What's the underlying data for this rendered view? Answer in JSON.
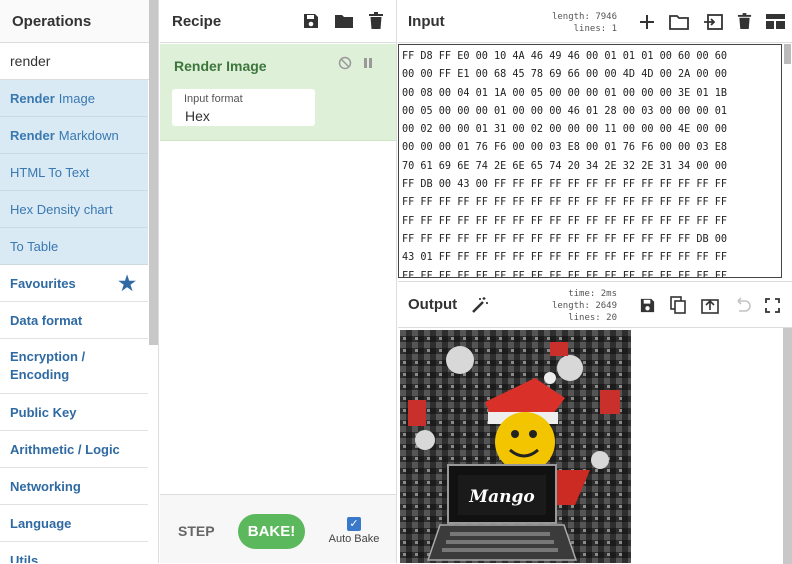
{
  "operations": {
    "title": "Operations",
    "search_value": "render",
    "results": [
      {
        "bold": "Render",
        "rest": "Image"
      },
      {
        "bold": "Render",
        "rest": "Markdown"
      },
      {
        "bold": "",
        "rest": "HTML To Text"
      },
      {
        "bold": "",
        "rest": "Hex Density chart"
      },
      {
        "bold": "",
        "rest": "To Table"
      }
    ],
    "categories": [
      "Favourites",
      "Data format",
      "Encryption / Encoding",
      "Public Key",
      "Arithmetic / Logic",
      "Networking",
      "Language",
      "Utils"
    ]
  },
  "recipe": {
    "title": "Recipe",
    "ingredient": {
      "name": "Render Image",
      "field_label": "Input format",
      "field_value": "Hex"
    },
    "step_label": "STEP",
    "bake_label": "BAKE!",
    "auto_bake_label": "Auto Bake"
  },
  "input": {
    "title": "Input",
    "length_label": "length:",
    "length_value": "7946",
    "lines_label": "lines:",
    "lines_value": "1",
    "hex_lines": [
      "FF D8 FF E0 00 10 4A 46 49 46 00 01 01 01 00 60 00 60",
      "00 00 FF E1 00 68 45 78 69 66 00 00 4D 4D 00 2A 00 00",
      "00 08 00 04 01 1A 00 05 00 00 00 01 00 00 00 3E 01 1B",
      "00 05 00 00 00 01 00 00 00 46 01 28 00 03 00 00 00 01",
      "00 02 00 00 01 31 00 02 00 00 00 11 00 00 00 4E 00 00",
      "00 00 00 01 76 F6 00 00 03 E8 00 01 76 F6 00 00 03 E8",
      "70 61 69 6E 74 2E 6E 65 74 20 34 2E 32 2E 31 34 00 00",
      "FF DB 00 43 00 FF FF FF FF FF FF FF FF FF FF FF FF FF",
      "FF FF FF FF FF FF FF FF FF FF FF FF FF FF FF FF FF FF",
      "FF FF FF FF FF FF FF FF FF FF FF FF FF FF FF FF FF FF",
      "FF FF FF FF FF FF FF FF FF FF FF FF FF FF FF FF DB 00",
      "43 01 FF FF FF FF FF FF FF FF FF FF FF FF FF FF FF FF",
      "FF FF FF FF FF FF FF FF FF FF FF FF FF FF FF FF FF FF"
    ]
  },
  "output": {
    "title": "Output",
    "time_label": "time:",
    "time_value": "2ms",
    "length_label": "length:",
    "length_value": "2649",
    "lines_label": "lines:",
    "lines_value": "20",
    "image_text": "Mango"
  }
}
